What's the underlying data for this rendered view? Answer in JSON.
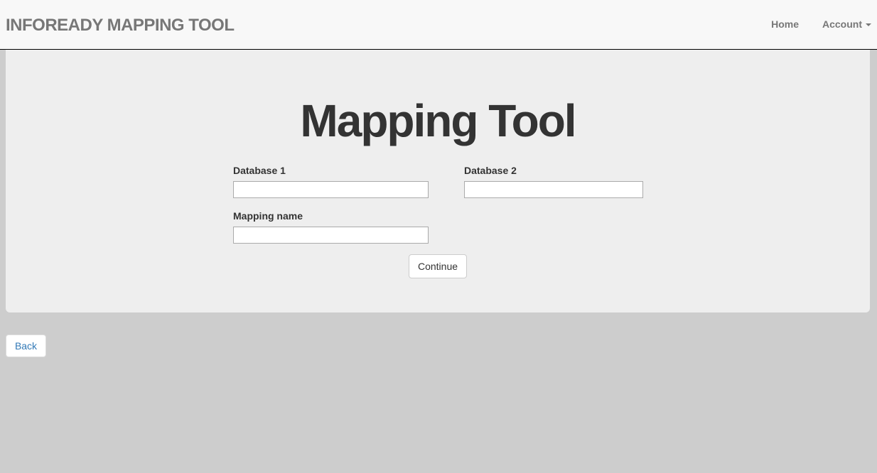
{
  "navbar": {
    "brand": "INFOREADY MAPPING TOOL",
    "links": {
      "home": "Home",
      "account": "Account"
    },
    "account_icon": "caret-down-icon"
  },
  "main": {
    "title": "Mapping Tool",
    "form": {
      "database1": {
        "label": "Database 1",
        "value": ""
      },
      "database2": {
        "label": "Database 2",
        "value": ""
      },
      "mapping_name": {
        "label": "Mapping name",
        "value": ""
      },
      "continue_label": "Continue"
    }
  },
  "footer": {
    "back_label": "Back"
  },
  "colors": {
    "navbar_bg": "#f8f8f8",
    "brand_text": "#777777",
    "jumbotron_bg": "#eeeeee",
    "page_bg": "#cdcdcd",
    "link": "#337ab7"
  }
}
